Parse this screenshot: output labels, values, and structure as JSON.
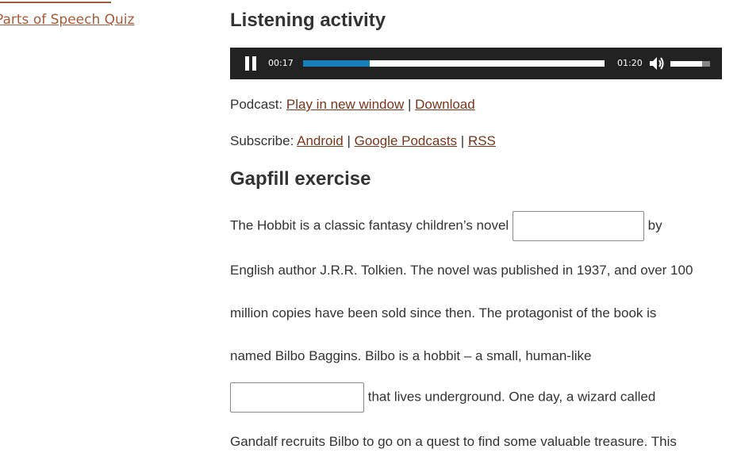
{
  "sidebar": {
    "link_label": "Parts of Speech Quiz"
  },
  "listening": {
    "heading": "Listening activity",
    "player": {
      "current_time": "00:17",
      "total_time": "01:20",
      "progress_fraction": 0.22,
      "volume_fraction": 0.8
    },
    "podcast": {
      "prefix": "Podcast: ",
      "play_new_window": "Play in new window",
      "separator": " | ",
      "download": "Download"
    },
    "subscribe": {
      "prefix": "Subscribe: ",
      "android": "Android",
      "sep1": " | ",
      "google": "Google Podcasts",
      "sep2": " | ",
      "rss": "RSS"
    }
  },
  "gapfill": {
    "heading": "Gapfill exercise",
    "line1_before": "The Hobbit is a classic fantasy children’s novel",
    "line1_after": "by",
    "line2": "English author J.R.R. Tolkien. The novel was published in 1937, and over 100",
    "line3": "million copies have been sold since then. The protagonist of the book is",
    "line4": "named Bilbo Baggins. Bilbo is a hobbit – a small, human-like",
    "line5_after": "that lives underground. One day, a wizard called",
    "line6": "Gandalf recruits Bilbo to go on a quest to find some valuable treasure. This",
    "input1_value": "",
    "input2_value": ""
  }
}
